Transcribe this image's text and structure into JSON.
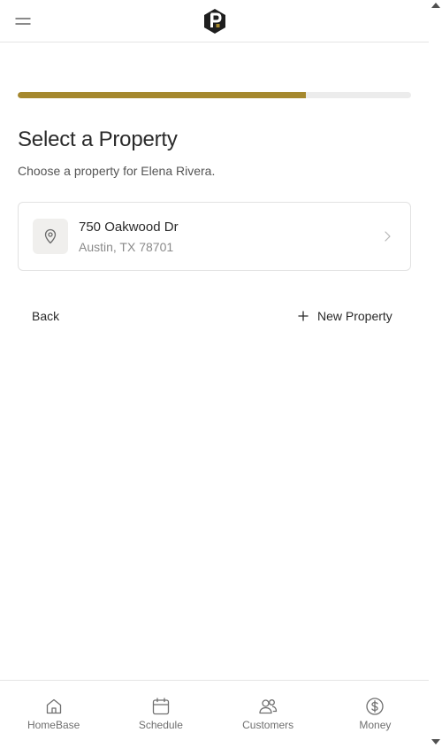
{
  "colors": {
    "accent": "#a5882e",
    "track": "#ececec",
    "text": "#2a2a2a",
    "muted": "#8a8a8a",
    "icon": "#6f6f6f"
  },
  "header": {
    "menu_icon": "hamburger-menu-icon",
    "logo_icon": "p-hexagon-logo-icon"
  },
  "progress": {
    "fraction": 0.733
  },
  "page": {
    "title": "Select a Property",
    "subtitle": "Choose a property for Elena Rivera."
  },
  "property": {
    "street": "750 Oakwood Dr",
    "city": "Austin, TX 78701",
    "icon": "map-pin-icon",
    "chevron": "chevron-right-icon"
  },
  "actions": {
    "back_label": "Back",
    "new_property_label": "New Property",
    "new_property_icon": "plus-icon"
  },
  "nav": {
    "items": [
      {
        "label": "HomeBase",
        "icon": "home-icon"
      },
      {
        "label": "Schedule",
        "icon": "calendar-icon"
      },
      {
        "label": "Customers",
        "icon": "users-icon"
      },
      {
        "label": "Money",
        "icon": "dollar-circle-icon"
      }
    ]
  }
}
